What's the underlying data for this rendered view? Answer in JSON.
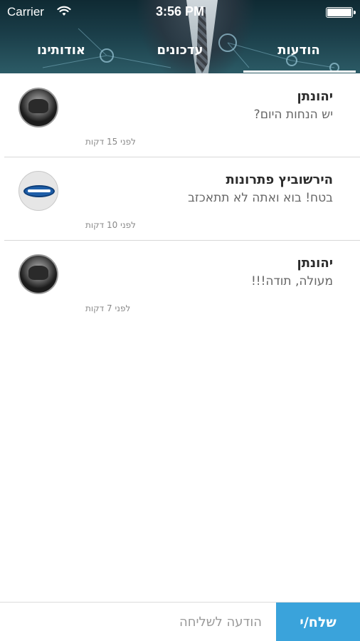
{
  "status_bar": {
    "carrier": "Carrier",
    "time": "3:56 PM"
  },
  "tabs": [
    {
      "label": "הודעות",
      "active": true
    },
    {
      "label": "עדכונים",
      "active": false
    },
    {
      "label": "אודותינו",
      "active": false
    }
  ],
  "messages": [
    {
      "sender": "יהונתן",
      "text": "יש הנחות היום?",
      "time": "לפני 15 דקות",
      "avatar": "person-photo"
    },
    {
      "sender": "הירשוביץ פתרונות",
      "text": "בטח! בוא ואתה לא תתאכזב",
      "time": "לפני 10 דקות",
      "avatar": "company-logo"
    },
    {
      "sender": "יהונתן",
      "text": "מעולה, תודה!!!",
      "time": "לפני 7 דקות",
      "avatar": "person-photo"
    }
  ],
  "composer": {
    "placeholder": "הודעה לשליחה",
    "send_label": "שלח/י"
  },
  "colors": {
    "accent": "#3aa3db",
    "header_bg": "#1a3d48"
  }
}
